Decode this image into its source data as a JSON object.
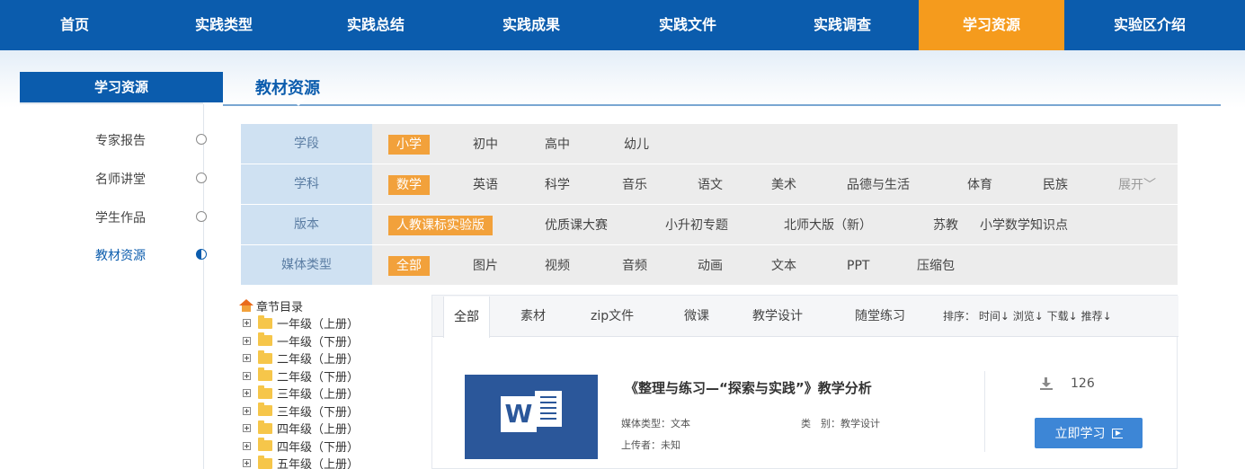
{
  "nav": {
    "items": [
      {
        "label": "首页"
      },
      {
        "label": "实践类型"
      },
      {
        "label": "实践总结"
      },
      {
        "label": "实践成果"
      },
      {
        "label": "实践文件"
      },
      {
        "label": "实践调查"
      },
      {
        "label": "学习资源",
        "active": true
      },
      {
        "label": "实验区介绍"
      }
    ]
  },
  "sidebar": {
    "title": "学习资源",
    "items": [
      {
        "label": "专家报告"
      },
      {
        "label": "名师讲堂"
      },
      {
        "label": "学生作品"
      },
      {
        "label": "教材资源",
        "active": true
      }
    ]
  },
  "content": {
    "title": "教材资源"
  },
  "filters": [
    {
      "label": "学段",
      "options": [
        "小学",
        "初中",
        "高中",
        "幼儿"
      ],
      "selected": 0
    },
    {
      "label": "学科",
      "options": [
        "数学",
        "英语",
        "科学",
        "音乐",
        "语文",
        "美术",
        "品德与生活",
        "体育",
        "民族"
      ],
      "selected": 0,
      "more": "展开"
    },
    {
      "label": "版本",
      "options": [
        "人教课标实验版",
        "优质课大赛",
        "小升初专题",
        "北师大版（新）",
        "苏教",
        "小学数学知识点"
      ],
      "selected": 0
    },
    {
      "label": "媒体类型",
      "options": [
        "全部",
        "图片",
        "视频",
        "音频",
        "动画",
        "文本",
        "PPT",
        "压缩包"
      ],
      "selected": 0
    }
  ],
  "tree": {
    "root": "章节目录",
    "nodes": [
      "一年级（上册）",
      "一年级（下册）",
      "二年级（上册）",
      "二年级（下册）",
      "三年级（上册）",
      "三年级（下册）",
      "四年级（上册）",
      "四年级（下册）",
      "五年级（上册）"
    ]
  },
  "tabs": [
    "全部",
    "素材",
    "zip文件",
    "微课",
    "教学设计",
    "随堂练习"
  ],
  "sort": {
    "label": "排序：",
    "options": [
      "时间",
      "浏览",
      "下载",
      "推荐"
    ]
  },
  "resource": {
    "title": "《整理与练习—“探索与实践”》教学分析",
    "media_type": "媒体类型：文本",
    "category": "类　别：教学设计",
    "uploader": "上传者：未知",
    "downloads": "126",
    "button_label": "立即学习",
    "icon_letter": "W"
  },
  "colors": {
    "brand": "#0b5cad",
    "active_nav": "#f59b1d",
    "selected": "#f2a13b",
    "button": "#3d86d6"
  }
}
